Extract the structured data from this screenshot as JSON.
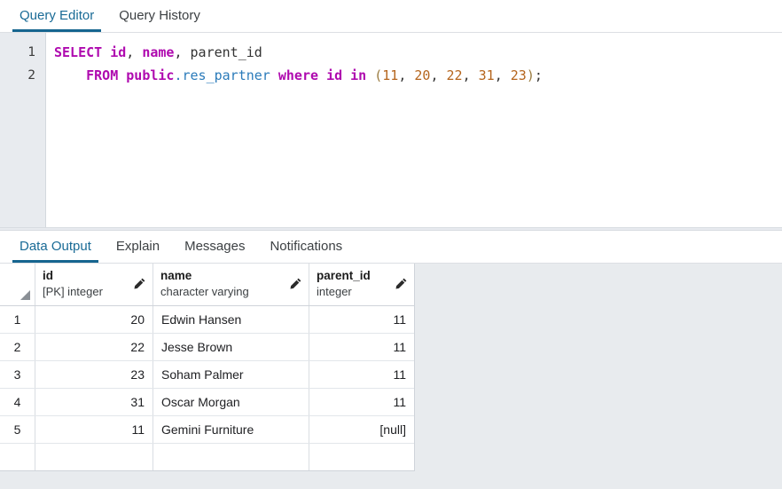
{
  "editor_tabs": {
    "items": [
      {
        "label": "Query Editor",
        "active": true
      },
      {
        "label": "Query History",
        "active": false
      }
    ]
  },
  "query_editor": {
    "lines": [
      {
        "number": "1"
      },
      {
        "number": "2"
      }
    ],
    "sql_tokens": {
      "l1_select": "SELECT",
      "l1_id": "id",
      "l1_comma1": ", ",
      "l1_name": "name",
      "l1_comma2": ", ",
      "l1_parent_id": "parent_id",
      "l2_indent": "    ",
      "l2_from": "FROM",
      "l2_space1": " ",
      "l2_schema": "public",
      "l2_dot_table": ".res_partner",
      "l2_space2": " ",
      "l2_where": "where",
      "l2_space3": " ",
      "l2_col": "id",
      "l2_space4": " ",
      "l2_in": "in",
      "l2_space5": " ",
      "l2_paren_open": "(",
      "l2_n1": "11",
      "l2_sep1": ", ",
      "l2_n2": "20",
      "l2_sep2": ", ",
      "l2_n3": "22",
      "l2_sep3": ", ",
      "l2_n4": "31",
      "l2_sep4": ", ",
      "l2_n5": "23",
      "l2_paren_close": ")",
      "l2_semicolon": ";"
    },
    "full_text": "SELECT id, name, parent_id\n    FROM public.res_partner where id in (11, 20, 22, 31, 23);"
  },
  "output_tabs": {
    "items": [
      {
        "label": "Data Output",
        "active": true
      },
      {
        "label": "Explain",
        "active": false
      },
      {
        "label": "Messages",
        "active": false
      },
      {
        "label": "Notifications",
        "active": false
      }
    ]
  },
  "data_output": {
    "columns": [
      {
        "name": "id",
        "type": "[PK] integer"
      },
      {
        "name": "name",
        "type": "character varying"
      },
      {
        "name": "parent_id",
        "type": "integer"
      }
    ],
    "rows": [
      {
        "rownum": "1",
        "id": "20",
        "name": "Edwin Hansen",
        "parent_id": "11"
      },
      {
        "rownum": "2",
        "id": "22",
        "name": "Jesse Brown",
        "parent_id": "11"
      },
      {
        "rownum": "3",
        "id": "23",
        "name": "Soham Palmer",
        "parent_id": "11"
      },
      {
        "rownum": "4",
        "id": "31",
        "name": "Oscar Morgan",
        "parent_id": "11"
      },
      {
        "rownum": "5",
        "id": "11",
        "name": "Gemini Furniture",
        "parent_id": "[null]"
      }
    ],
    "new_row": {
      "rownum": "",
      "id": "",
      "name": "",
      "parent_id": ""
    }
  },
  "colors": {
    "accent": "#16658f",
    "keyword": "#af0aaf",
    "table": "#2b7bba",
    "number": "#b5651d",
    "null_text": "#64748b",
    "gutter_bg": "#e8ebef",
    "panel_bg": "#e8ebee"
  }
}
